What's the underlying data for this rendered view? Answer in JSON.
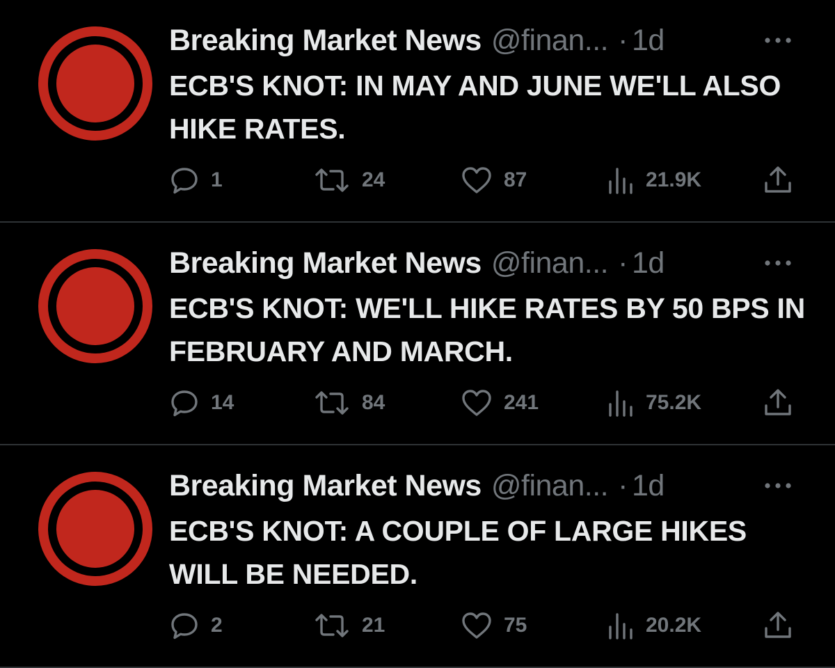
{
  "colors": {
    "background": "#000000",
    "text_primary": "#e7e9ea",
    "text_secondary": "#71767b",
    "avatar_red": "#c1271d",
    "divider": "#2f3336"
  },
  "icons": {
    "more": "more-horizontal-icon",
    "reply": "speech-bubble-icon",
    "repost": "repost-arrows-icon",
    "like": "heart-outline-icon",
    "views": "bar-chart-icon",
    "share": "upload-arrow-icon"
  },
  "tweets": [
    {
      "author": "Breaking Market News",
      "handle": "@finan...",
      "separator": "·",
      "age": "1d",
      "text": "ECB'S KNOT: IN MAY AND JUNE WE'LL ALSO HIKE RATES.",
      "replies": "1",
      "reposts": "24",
      "likes": "87",
      "views": "21.9K"
    },
    {
      "author": "Breaking Market News",
      "handle": "@finan...",
      "separator": "·",
      "age": "1d",
      "text": "ECB'S KNOT: WE'LL HIKE RATES BY 50 BPS IN FEBRUARY AND MARCH.",
      "replies": "14",
      "reposts": "84",
      "likes": "241",
      "views": "75.2K"
    },
    {
      "author": "Breaking Market News",
      "handle": "@finan...",
      "separator": "·",
      "age": "1d",
      "text": "ECB'S KNOT: A COUPLE OF LARGE HIKES WILL BE NEEDED.",
      "replies": "2",
      "reposts": "21",
      "likes": "75",
      "views": "20.2K"
    }
  ]
}
